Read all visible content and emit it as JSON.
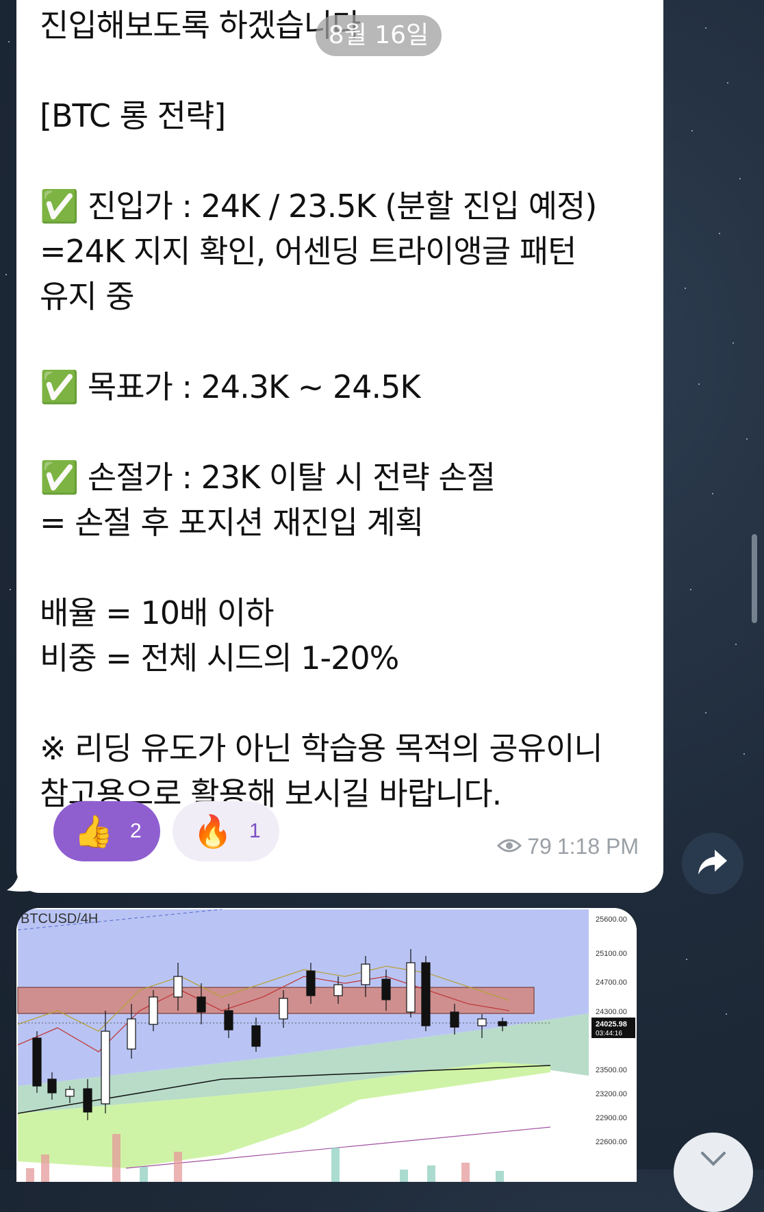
{
  "date_pill": "8월 16일",
  "message": {
    "text": "진입해보도록 하겠습니다\n\n[BTC 롱 전략]\n\n✅ 진입가 : 24K / 23.5K (분할 진입 예정)\n=24K 지지 확인, 어센딩 트라이앵글 패턴\n유지 중\n\n✅ 목표가 : 24.3K ~ 24.5K\n\n✅ 손절가 : 23K 이탈 시 전략 손절\n= 손절 후 포지션 재진입 계획\n\n배율 = 10배 이하\n비중 = 전체 시드의 1-20%\n\n※ 리딩 유도가 아닌 학습용 목적의 공유이니\n참고용으로 활용해 보시길 바랍니다."
  },
  "reactions": [
    {
      "emoji": "👍",
      "count": "2"
    },
    {
      "emoji": "🔥",
      "count": "1"
    }
  ],
  "meta": {
    "views": "79",
    "time": "1:18 PM"
  },
  "chart": {
    "symbol": "BTCUSD/4H",
    "price_labels": [
      "25600.00",
      "25100.00",
      "24700.00",
      "24300.00",
      "23500.00",
      "23200.00",
      "22900.00",
      "22600.00"
    ],
    "current_price": "24025.98",
    "countdown": "03:44:16"
  },
  "colors": {
    "accent": "#8f5fd0",
    "bubble": "#ffffff"
  }
}
